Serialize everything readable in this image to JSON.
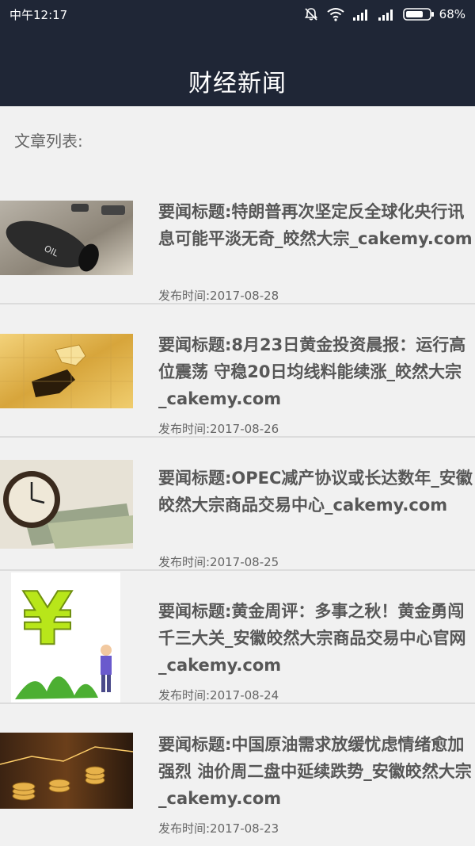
{
  "status_bar": {
    "time": "中午12:17",
    "battery": "68%",
    "icons": [
      "mute-bell-icon",
      "wifi-icon",
      "signal-icon",
      "signal-icon",
      "battery-icon"
    ]
  },
  "header": {
    "title": "财经新闻"
  },
  "section": {
    "label": "文章列表:"
  },
  "articles": [
    {
      "title": "要闻标题:特朗普再次坚定反全球化央行讯息可能平淡无奇_皎然大宗_cakemy.com",
      "date": "发布时间:2017-08-28",
      "thumb": "oil-barrel-image"
    },
    {
      "title": "要闻标题:8月23日黄金投资晨报：运行高位震荡 守稳20日均线料能续涨_皎然大宗_cakemy.com",
      "date": "发布时间:2017-08-26",
      "thumb": "gold-puzzle-image"
    },
    {
      "title": "要闻标题:OPEC减产协议或长达数年_安徽皎然大宗商品交易中心_cakemy.com",
      "date": "发布时间:2017-08-25",
      "thumb": "clock-money-image"
    },
    {
      "title": "要闻标题:黄金周评：多事之秋！黄金勇闯千三大关_安徽皎然大宗商品交易中心官网_cakemy.com",
      "date": "发布时间:2017-08-24",
      "thumb": "yuan-plant-image"
    },
    {
      "title": "要闻标题:中国原油需求放缓忧虑情绪愈加强烈 油价周二盘中延续跌势_安徽皎然大宗_cakemy.com",
      "date": "发布时间:2017-08-23",
      "thumb": "coins-chart-image"
    }
  ]
}
